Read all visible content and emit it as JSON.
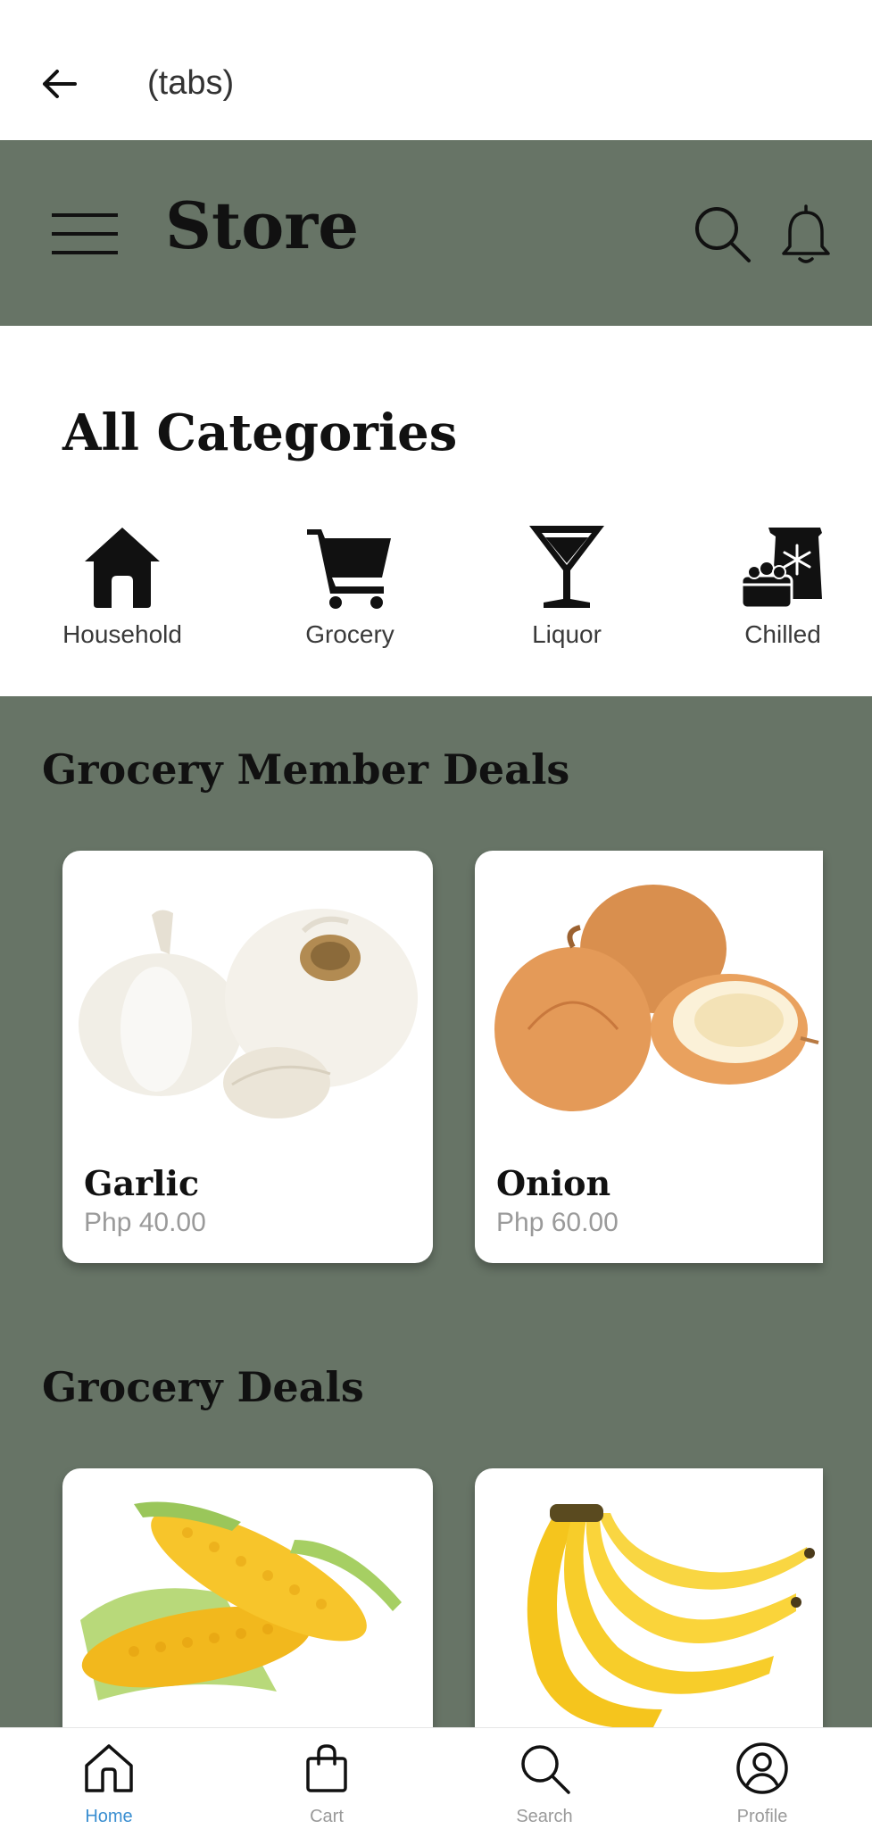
{
  "topbar": {
    "title": "(tabs)"
  },
  "header": {
    "title": "Store"
  },
  "categories": {
    "heading": "All Categories",
    "items": [
      {
        "label": "Household",
        "icon": "house-icon"
      },
      {
        "label": "Grocery",
        "icon": "shopping-cart-icon"
      },
      {
        "label": "Liquor",
        "icon": "cocktail-glass-icon"
      },
      {
        "label": "Chilled",
        "icon": "frozen-food-icon"
      }
    ]
  },
  "member_deals": {
    "title": "Grocery Member Deals",
    "products": [
      {
        "name": "Garlic",
        "price": "Php 40.00"
      },
      {
        "name": "Onion",
        "price": "Php 60.00"
      }
    ]
  },
  "grocery_deals": {
    "title": "Grocery Deals",
    "products": [
      {
        "image": "corn"
      },
      {
        "image": "banana"
      }
    ]
  },
  "bottom_nav": {
    "items": [
      {
        "label": "Home",
        "icon": "home-icon",
        "active": true
      },
      {
        "label": "Cart",
        "icon": "shopping-bag-icon",
        "active": false
      },
      {
        "label": "Search",
        "icon": "search-icon",
        "active": false
      },
      {
        "label": "Profile",
        "icon": "profile-icon",
        "active": false
      }
    ]
  },
  "colors": {
    "header_bg": "#677466",
    "active_nav": "#3b8fd1"
  }
}
